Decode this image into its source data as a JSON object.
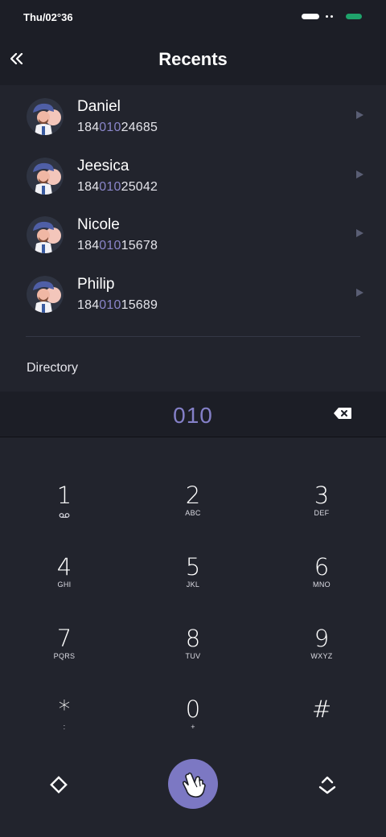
{
  "status": {
    "time": "Thu/02°36",
    "battery_color": "#1fa36b"
  },
  "header": {
    "title": "Recents",
    "back_icon": "double-chevron-left-icon"
  },
  "recents": [
    {
      "name": "Daniel",
      "number_prefix": "184",
      "number_match": "010",
      "number_suffix": "24685"
    },
    {
      "name": "Jeesica",
      "number_prefix": "184",
      "number_match": "010",
      "number_suffix": "25042"
    },
    {
      "name": "Nicole",
      "number_prefix": "184",
      "number_match": "010",
      "number_suffix": "15678"
    },
    {
      "name": "Philip",
      "number_prefix": "184",
      "number_match": "010",
      "number_suffix": "15689"
    }
  ],
  "directory": {
    "title": "Directory"
  },
  "dialer": {
    "input": "010",
    "backspace_icon": "backspace-icon",
    "accent_color": "#7c78c3",
    "keys": [
      {
        "digit": "1",
        "letters": ""
      },
      {
        "digit": "2",
        "letters": "ABC"
      },
      {
        "digit": "3",
        "letters": "DEF"
      },
      {
        "digit": "4",
        "letters": "GHI"
      },
      {
        "digit": "5",
        "letters": "JKL"
      },
      {
        "digit": "6",
        "letters": "MNO"
      },
      {
        "digit": "7",
        "letters": "PQRS"
      },
      {
        "digit": "8",
        "letters": "TUV"
      },
      {
        "digit": "9",
        "letters": "WXYZ"
      },
      {
        "digit": "*",
        "letters": ":"
      },
      {
        "digit": "0",
        "letters": "+"
      },
      {
        "digit": "#",
        "letters": ""
      }
    ],
    "left_icon": "diamond-icon",
    "call_icon": "hand-pointer-icon",
    "right_icon": "chevron-up-down-icon"
  }
}
